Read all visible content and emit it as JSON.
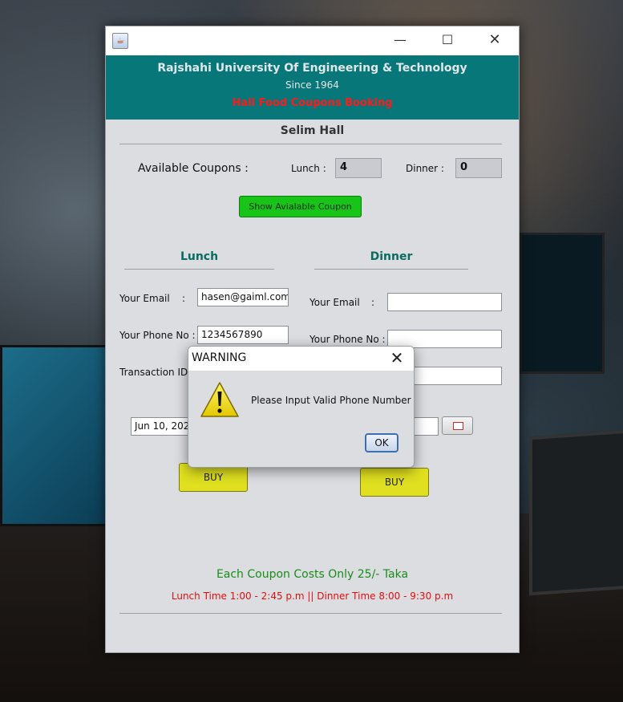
{
  "window": {
    "controls": {
      "minimize": "—",
      "maximize": "☐",
      "close": "✕"
    },
    "app_icon": "java-cup-icon"
  },
  "header": {
    "university": "Rajshahi University Of Engineering & Technology",
    "since": "Since 1964",
    "booking_title": "Hall Food Coupons Booking",
    "colors": {
      "header_bg": "#08777a",
      "booking_title": "#ff1a1a"
    }
  },
  "hall_name": "Selim Hall",
  "availability": {
    "label": "Available Coupons :",
    "lunch_label": "Lunch :",
    "lunch_value": "4",
    "dinner_label": "Dinner :",
    "dinner_value": "0",
    "show_button": "Show Avialable Coupon"
  },
  "lunch": {
    "title": "Lunch",
    "email_label": "Your Email",
    "email_colon": ":",
    "email_value": "hasen@gaiml.com",
    "phone_label": "Your Phone No :",
    "phone_value": "1234567890",
    "txn_label": "Transaction ID :",
    "date_value": "Jun 10, 2022",
    "buy": "BUY"
  },
  "dinner": {
    "title": "Dinner",
    "email_label": "Your Email",
    "email_colon": ":",
    "email_value": "",
    "phone_label": "Your Phone No :",
    "phone_value": "",
    "txn_value": "",
    "buy": "BUY"
  },
  "footer": {
    "cost": "Each Coupon Costs Only 25/- Taka",
    "times": "Lunch Time 1:00 - 2:45 p.m  || Dinner Time 8:00 - 9:30 p.m"
  },
  "dialog": {
    "title": "WARNING",
    "close": "✕",
    "message": "Please Input Valid Phone Number",
    "ok": "OK",
    "icon": "warning-icon"
  }
}
